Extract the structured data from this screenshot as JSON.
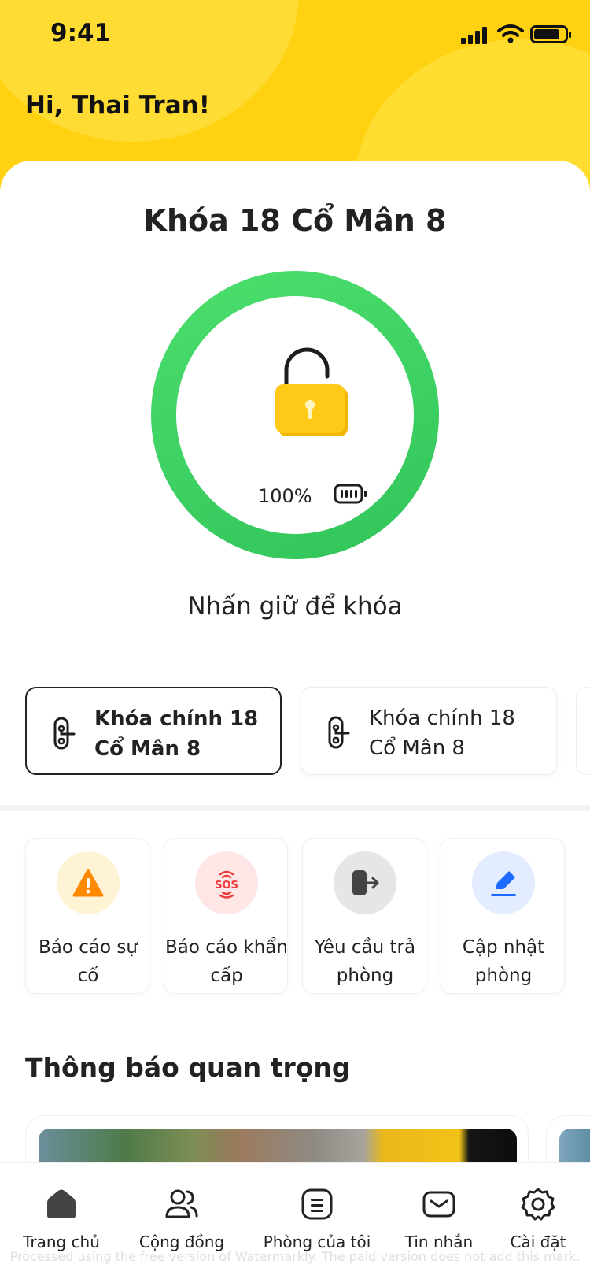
{
  "status_bar": {
    "time": "9:41"
  },
  "header": {
    "greeting": "Hi, Thai Tran!"
  },
  "lock": {
    "title": "Khóa 18 Cổ Mân 8",
    "battery_percent": "100%",
    "hold_hint": "Nhấn giữ để khóa",
    "state_color": "#3fd366"
  },
  "lock_cards": [
    {
      "label": "Khóa chính 18 Cổ Mân 8",
      "selected": true
    },
    {
      "label": "Khóa chính 18 Cổ Mân 8",
      "selected": false
    }
  ],
  "actions": [
    {
      "label": "Báo cáo sự cố",
      "icon": "warning-icon",
      "bg": "#fff3d6",
      "color": "#ff8a00"
    },
    {
      "label": "Báo cáo khẩn cấp",
      "icon": "sos-icon",
      "bg": "#ffe6e6",
      "color": "#ee3b3b"
    },
    {
      "label": "Yêu cầu trả phòng",
      "icon": "checkout-icon",
      "bg": "#e6e6e6",
      "color": "#444444"
    },
    {
      "label": "Cập nhật phòng",
      "icon": "edit-icon",
      "bg": "#e4ecff",
      "color": "#1f6bff"
    }
  ],
  "notices": {
    "title": "Thông báo quan trọng"
  },
  "tabbar": {
    "items": [
      {
        "label": "Trang chủ",
        "icon": "home-icon",
        "active": true
      },
      {
        "label": "Cộng đồng",
        "icon": "community-icon",
        "active": false
      },
      {
        "label": "Phòng của tôi",
        "icon": "room-icon",
        "active": false
      },
      {
        "label": "Tin nhắn",
        "icon": "message-icon",
        "active": false
      },
      {
        "label": "Cài đặt",
        "icon": "settings-icon",
        "active": false
      }
    ]
  },
  "watermark": "Processed using the free version of Watermarkly. The paid version does not add this mark."
}
